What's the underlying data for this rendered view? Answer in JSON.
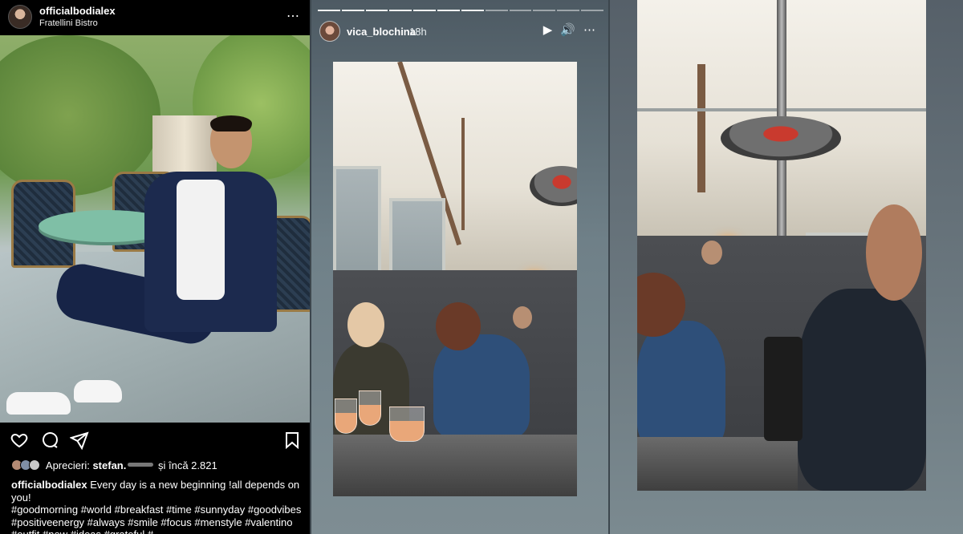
{
  "post": {
    "username": "officialbodialex",
    "location": "Fratellini Bistro",
    "more_icon": "⋯",
    "likes": {
      "label": "Aprecieri:",
      "first_user": "stefan.",
      "and_more": "și încă 2.821"
    },
    "caption": {
      "username": "officialbodialex",
      "text": " Every day is a new beginning !all depends on you!",
      "hashtags": "#goodmorning #world #breakfast #time #sunnyday #goodvibes #positiveenergy #always #smile #focus #menstyle #valentino #outfit #new #ideas #grateful #"
    },
    "icons": [
      "heart-icon",
      "comment-icon",
      "share-icon",
      "bookmark-icon"
    ]
  },
  "story": {
    "username": "vica_blochina",
    "time": "18h",
    "progress": {
      "segments": 12,
      "completed": 7
    },
    "controls": {
      "play": "▶",
      "sound": "🔊",
      "more": "⋯"
    }
  },
  "colors": {
    "instagram_bg": "#000000",
    "story_bg": "#6f8088",
    "text": "#ffffff"
  }
}
